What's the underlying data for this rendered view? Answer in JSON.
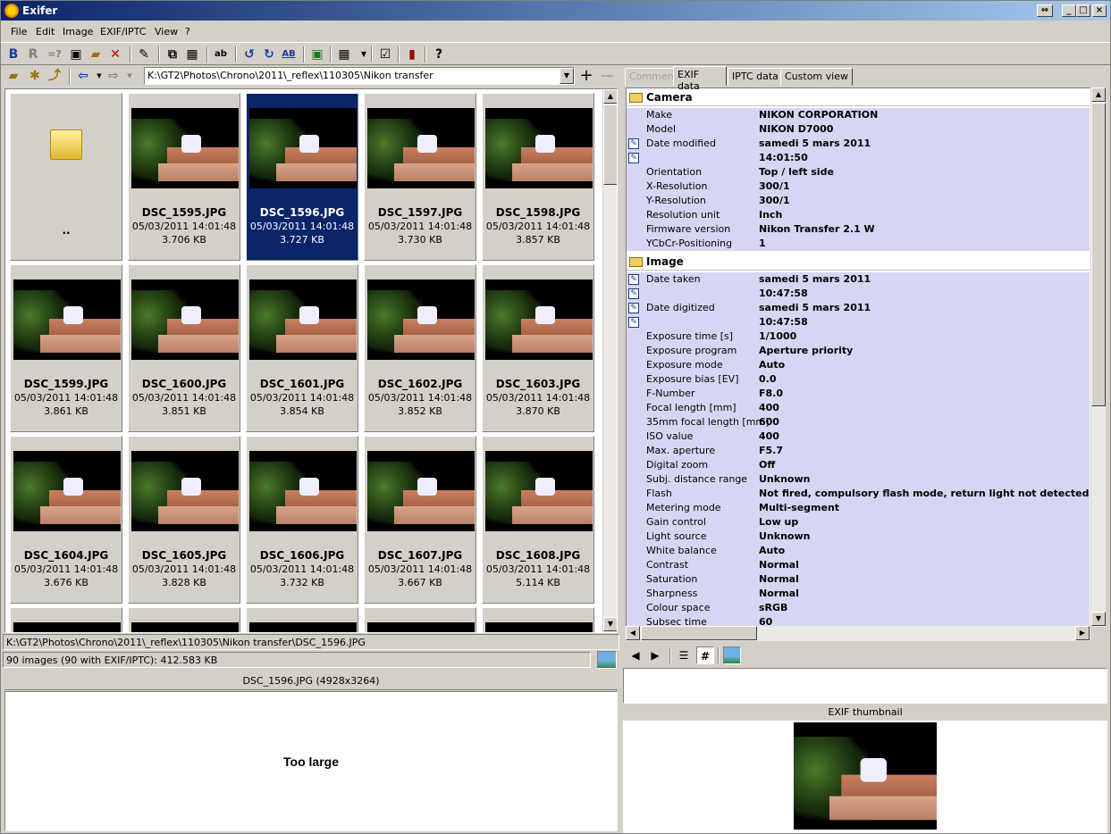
{
  "app": {
    "title": "Exifer"
  },
  "menu": [
    "File",
    "Edit",
    "Image",
    "EXIF/IPTC",
    "View",
    "?"
  ],
  "toolbar": {
    "bold_label": "B",
    "r_label": "R",
    "eq_label": "=?",
    "ab_label": "ab",
    "ab2_label": "AB",
    "help_label": "?"
  },
  "nav": {
    "path": "K:\\GT2\\Photos\\Chrono\\2011\\_reflex\\110305\\Nikon transfer",
    "plus": "+",
    "minus": "—"
  },
  "thumbs": [
    {
      "name": "..",
      "date": "",
      "size": "",
      "folder": true
    },
    {
      "name": "DSC_1595.JPG",
      "date": "05/03/2011 14:01:48",
      "size": "3.706 KB"
    },
    {
      "name": "DSC_1596.JPG",
      "date": "05/03/2011 14:01:48",
      "size": "3.727 KB",
      "selected": true
    },
    {
      "name": "DSC_1597.JPG",
      "date": "05/03/2011 14:01:48",
      "size": "3.730 KB"
    },
    {
      "name": "DSC_1598.JPG",
      "date": "05/03/2011 14:01:48",
      "size": "3.857 KB"
    },
    {
      "name": "DSC_1599.JPG",
      "date": "05/03/2011 14:01:48",
      "size": "3.861 KB"
    },
    {
      "name": "DSC_1600.JPG",
      "date": "05/03/2011 14:01:48",
      "size": "3.851 KB"
    },
    {
      "name": "DSC_1601.JPG",
      "date": "05/03/2011 14:01:48",
      "size": "3.854 KB"
    },
    {
      "name": "DSC_1602.JPG",
      "date": "05/03/2011 14:01:48",
      "size": "3.852 KB"
    },
    {
      "name": "DSC_1603.JPG",
      "date": "05/03/2011 14:01:48",
      "size": "3.870 KB"
    },
    {
      "name": "DSC_1604.JPG",
      "date": "05/03/2011 14:01:48",
      "size": "3.676 KB"
    },
    {
      "name": "DSC_1605.JPG",
      "date": "05/03/2011 14:01:48",
      "size": "3.828 KB"
    },
    {
      "name": "DSC_1606.JPG",
      "date": "05/03/2011 14:01:48",
      "size": "3.732 KB"
    },
    {
      "name": "DSC_1607.JPG",
      "date": "05/03/2011 14:01:48",
      "size": "3.667 KB"
    },
    {
      "name": "DSC_1608.JPG",
      "date": "05/03/2011 14:01:48",
      "size": "5.114 KB"
    }
  ],
  "status": {
    "path": "K:\\GT2\\Photos\\Chrono\\2011\\_reflex\\110305\\Nikon transfer\\DSC_1596.JPG",
    "count": "90 images (90 with EXIF/IPTC): 412.583 KB"
  },
  "preview": {
    "header": "DSC_1596.JPG (4928x3264)",
    "message": "Too large"
  },
  "tabs": [
    "Comment",
    "EXIF data",
    "IPTC data",
    "Custom view"
  ],
  "exif": {
    "camera_title": "Camera",
    "camera": [
      {
        "k": "Make",
        "v": "NIKON CORPORATION"
      },
      {
        "k": "Model",
        "v": "NIKON D7000"
      },
      {
        "k": "Date modified",
        "v": "samedi 5 mars 2011",
        "ed": true
      },
      {
        "k": "",
        "v": "14:01:50",
        "ed": true
      },
      {
        "k": "Orientation",
        "v": "Top / left side"
      },
      {
        "k": "X-Resolution",
        "v": "300/1"
      },
      {
        "k": "Y-Resolution",
        "v": "300/1"
      },
      {
        "k": "Resolution unit",
        "v": "Inch"
      },
      {
        "k": "Firmware version",
        "v": "Nikon Transfer 2.1 W"
      },
      {
        "k": "YCbCr-Positioning",
        "v": "1"
      }
    ],
    "image_title": "Image",
    "image": [
      {
        "k": "Date taken",
        "v": "samedi 5 mars 2011",
        "ed": true
      },
      {
        "k": "",
        "v": "10:47:58",
        "ed": true
      },
      {
        "k": "Date digitized",
        "v": "samedi 5 mars 2011",
        "ed": true
      },
      {
        "k": "",
        "v": "10:47:58",
        "ed": true
      },
      {
        "k": "Exposure time [s]",
        "v": "1/1000"
      },
      {
        "k": "Exposure program",
        "v": "Aperture priority"
      },
      {
        "k": "Exposure mode",
        "v": "Auto"
      },
      {
        "k": "Exposure bias [EV]",
        "v": "0.0"
      },
      {
        "k": "F-Number",
        "v": "F8.0"
      },
      {
        "k": "Focal length [mm]",
        "v": "400"
      },
      {
        "k": "35mm focal length [mm]",
        "v": "600"
      },
      {
        "k": "ISO value",
        "v": "400"
      },
      {
        "k": "Max. aperture",
        "v": "F5.7"
      },
      {
        "k": "Digital zoom",
        "v": "Off"
      },
      {
        "k": "Subj. distance range",
        "v": "Unknown"
      },
      {
        "k": "Flash",
        "v": "Not fired, compulsory flash mode, return light not detected"
      },
      {
        "k": "Metering mode",
        "v": "Multi-segment"
      },
      {
        "k": "Gain control",
        "v": "Low up"
      },
      {
        "k": "Light source",
        "v": "Unknown"
      },
      {
        "k": "White balance",
        "v": "Auto"
      },
      {
        "k": "Contrast",
        "v": "Normal"
      },
      {
        "k": "Saturation",
        "v": "Normal"
      },
      {
        "k": "Sharpness",
        "v": "Normal"
      },
      {
        "k": "Colour space",
        "v": "sRGB"
      },
      {
        "k": "Subsec time",
        "v": "60"
      }
    ]
  },
  "thumbnail_header": "EXIF thumbnail",
  "colors": {
    "selection": "#0a246a",
    "exif_row": "#d6d6f4",
    "face": "#d4d0c8"
  }
}
